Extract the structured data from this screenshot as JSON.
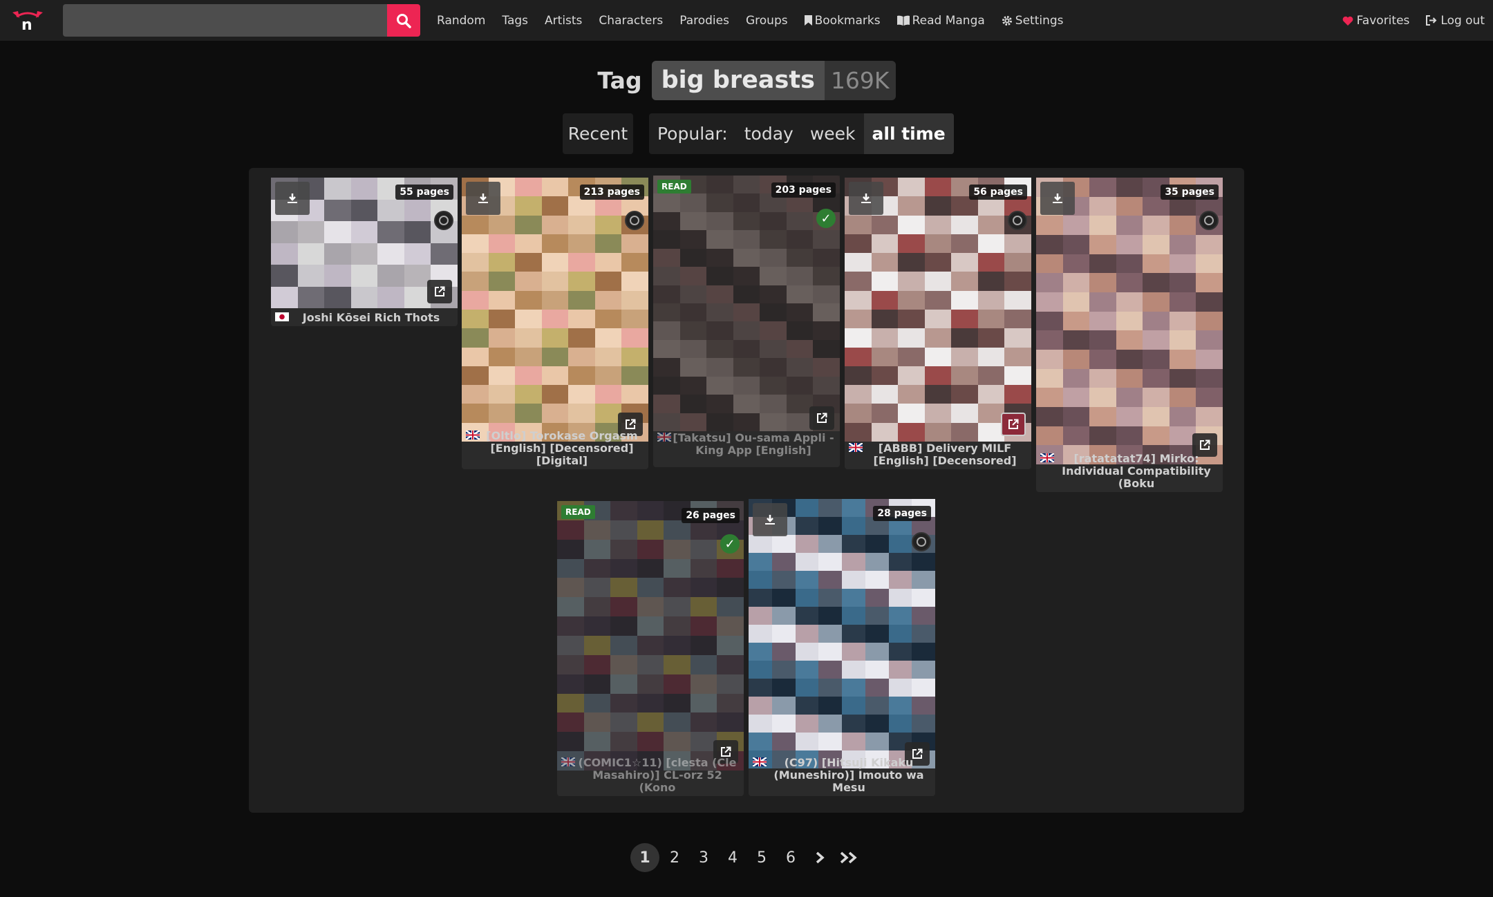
{
  "nav": {
    "search_placeholder": "",
    "menu": [
      {
        "label": "Random"
      },
      {
        "label": "Tags"
      },
      {
        "label": "Artists"
      },
      {
        "label": "Characters"
      },
      {
        "label": "Parodies"
      },
      {
        "label": "Groups"
      },
      {
        "label": "Bookmarks",
        "icon": "bookmark-icon"
      },
      {
        "label": "Read Manga",
        "icon": "book-icon"
      },
      {
        "label": "Settings",
        "icon": "gear-icon"
      }
    ],
    "right": [
      {
        "label": "Favorites",
        "icon": "heart-icon",
        "icon_color": "#ed2553"
      },
      {
        "label": "Log out",
        "icon": "logout-icon"
      }
    ]
  },
  "header": {
    "tag_word": "Tag",
    "tag_name": "big breasts",
    "tag_count": "169K"
  },
  "sort": {
    "recent": "Recent",
    "popular_label": "Popular:",
    "today": "today",
    "week": "week",
    "all_time": "all time",
    "active": "all time"
  },
  "galleries": [
    {
      "pages": "55 pages",
      "title": "Joshi Kōsei Rich Thots",
      "lang": "japanese",
      "read": false
    },
    {
      "pages": "213 pages",
      "title": "[Oltlo] Torokase Orgasm [English] [Decensored] [Digital]",
      "lang": "english",
      "read": false
    },
    {
      "pages": "203 pages",
      "title": "[Takatsu] Ou-sama Appli - King App [English]",
      "lang": "english",
      "read": true,
      "read_label": "READ"
    },
    {
      "pages": "56 pages",
      "title": "[ABBB] Delivery MILF [English] [Decensored]",
      "lang": "english",
      "read": false
    },
    {
      "pages": "35 pages",
      "title": "[ratatatat74] Mirko: Individual Compatibility (Boku",
      "lang": "english",
      "read": false
    },
    {
      "pages": "26 pages",
      "title": "(COMIC1☆11) [clesta (Cle Masahiro)] CL-orz 52 (Kono",
      "lang": "english",
      "read": true,
      "read_label": "READ"
    },
    {
      "pages": "28 pages",
      "title": "(C97) [Hitsuji Kikaku (Muneshiro)] Imouto wa Mesu",
      "lang": "english",
      "read": false
    }
  ],
  "pagination": {
    "pages": [
      "1",
      "2",
      "3",
      "4",
      "5",
      "6"
    ],
    "current": "1",
    "next": "›",
    "last": "»"
  },
  "colors": {
    "accent": "#ed2553",
    "read_green": "#2e7d32"
  }
}
